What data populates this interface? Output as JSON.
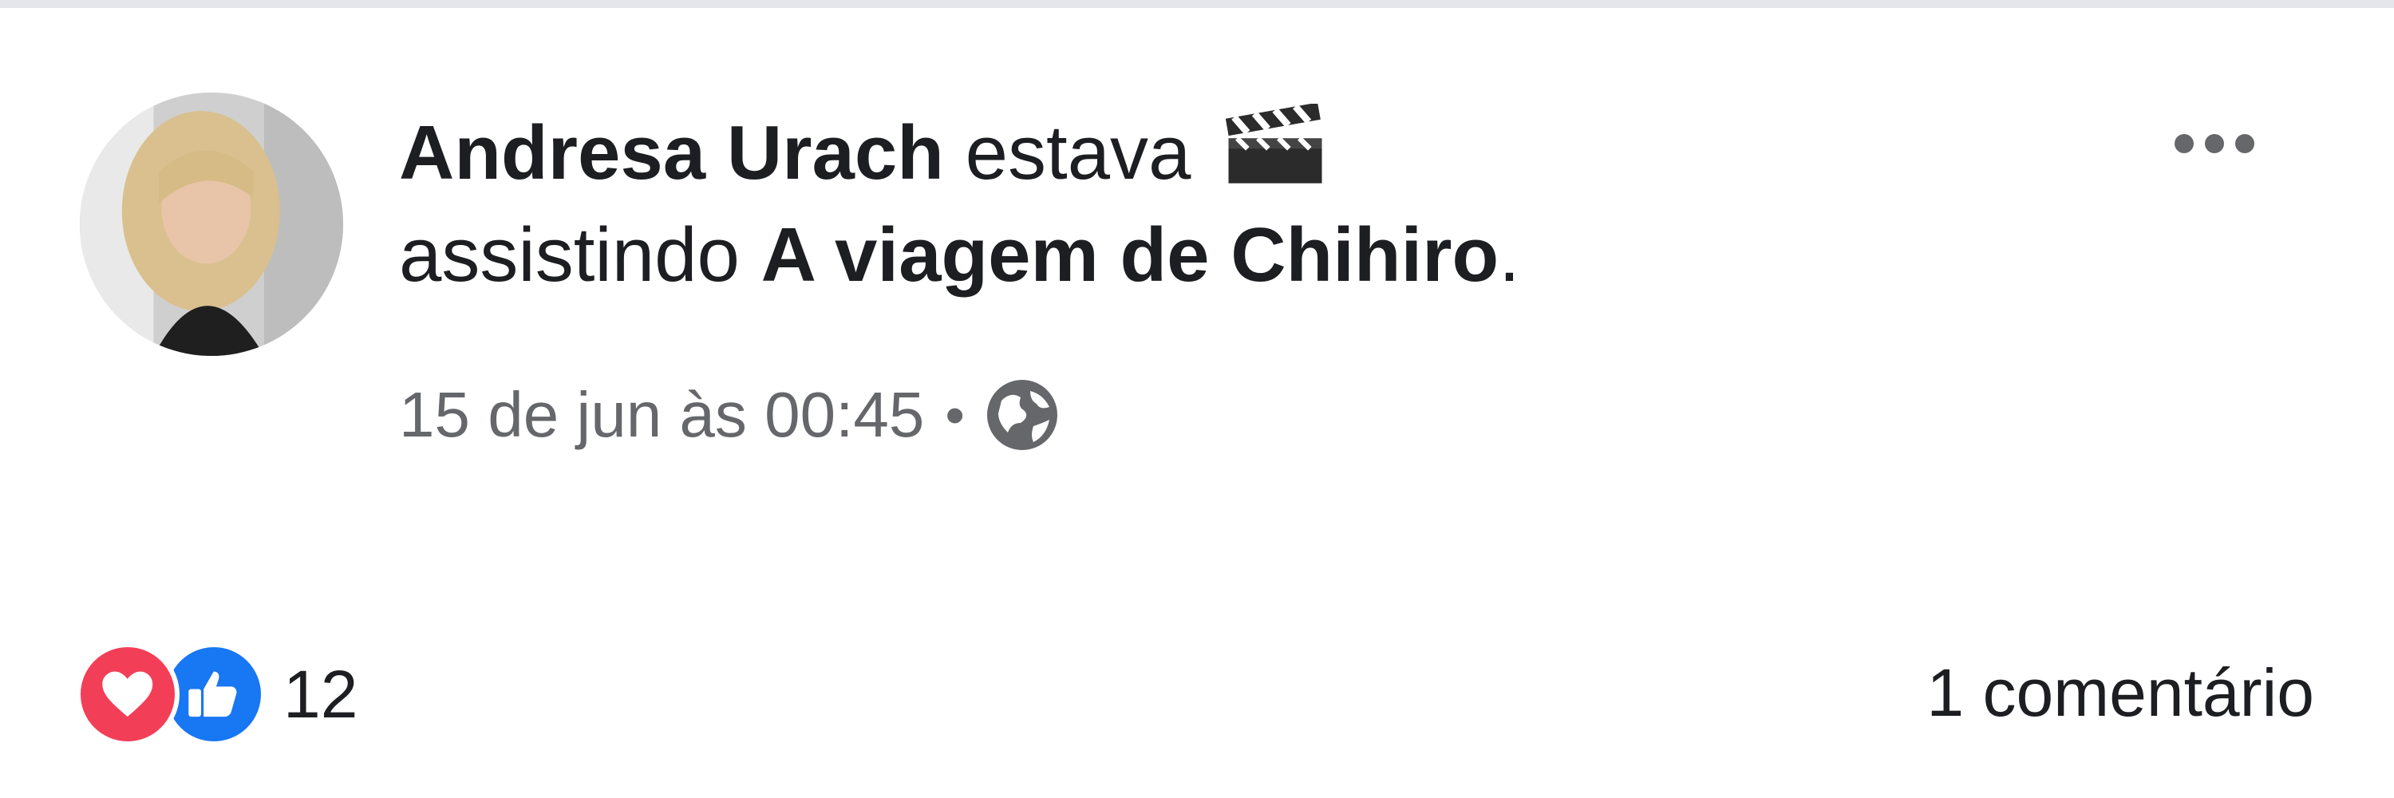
{
  "post": {
    "author_name": "Andresa Urach",
    "activity_prefix": "estava",
    "activity_icon": "clapperboard-icon",
    "activity_verb": "assistindo",
    "activity_object": "A viagem de Chihiro",
    "activity_suffix": ".",
    "timestamp": "15 de jun às 00:45",
    "meta_separator": "•",
    "privacy_icon": "globe-icon"
  },
  "actions": {
    "more_icon": "more-options-icon"
  },
  "footer": {
    "reaction_icons": [
      "love-icon",
      "like-icon"
    ],
    "reaction_count": "12",
    "comments_label": "1 comentário"
  },
  "colors": {
    "love": "#f33e58",
    "like": "#1877f2",
    "secondary_text": "#65676b",
    "primary_text": "#1c1e21"
  }
}
